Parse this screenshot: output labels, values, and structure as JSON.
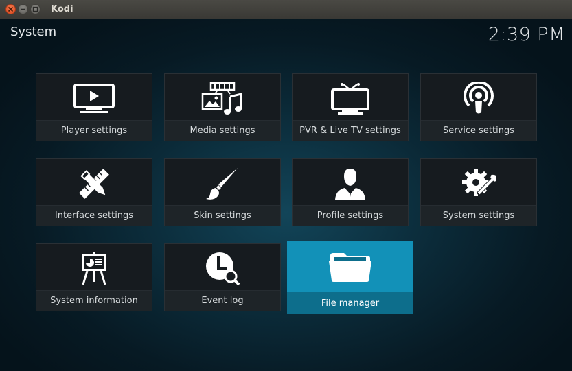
{
  "window": {
    "title": "Kodi"
  },
  "header": {
    "title": "System",
    "clock": "2:39 PM"
  },
  "tiles": [
    {
      "label": "Player settings",
      "icon": "player-icon"
    },
    {
      "label": "Media settings",
      "icon": "media-icon"
    },
    {
      "label": "PVR & Live TV settings",
      "icon": "tv-icon"
    },
    {
      "label": "Service settings",
      "icon": "service-icon"
    },
    {
      "label": "Interface settings",
      "icon": "interface-icon"
    },
    {
      "label": "Skin settings",
      "icon": "brush-icon"
    },
    {
      "label": "Profile settings",
      "icon": "profile-icon"
    },
    {
      "label": "System settings",
      "icon": "gear-wrench-icon"
    },
    {
      "label": "System information",
      "icon": "presentation-icon"
    },
    {
      "label": "Event log",
      "icon": "clock-search-icon"
    },
    {
      "label": "File manager",
      "icon": "folder-icon",
      "focused": true
    }
  ],
  "colors": {
    "accent": "#1291b8",
    "tile_bg": "#161b1f",
    "close_button": "#e95420"
  }
}
